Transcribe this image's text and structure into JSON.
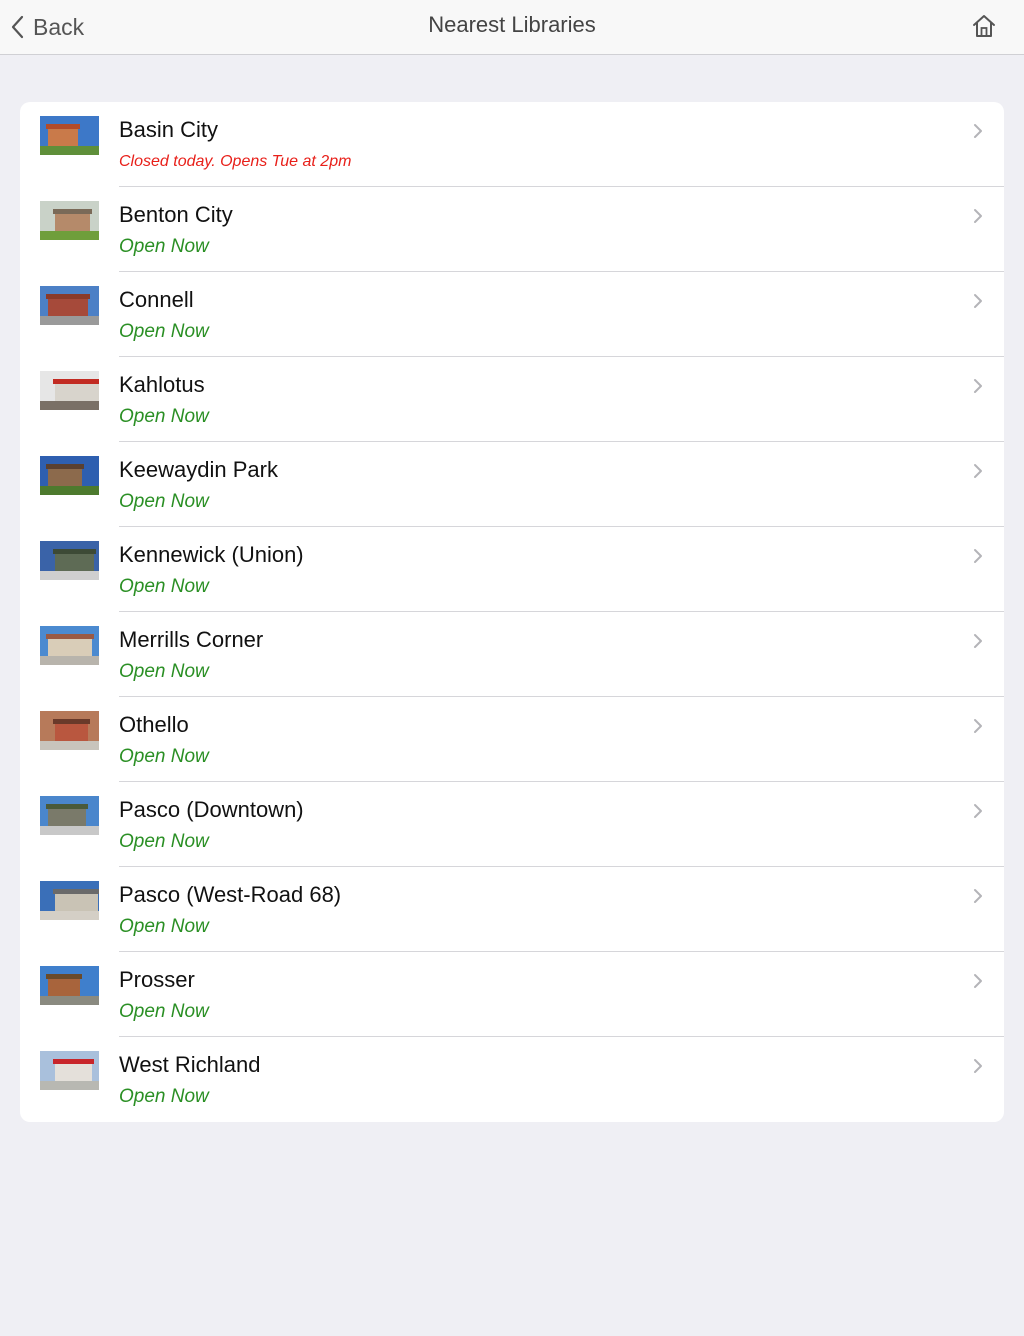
{
  "header": {
    "back_label": "Back",
    "title": "Nearest Libraries"
  },
  "libraries": [
    {
      "name": "Basin City",
      "status": "Closed today. Opens Tue at 2pm",
      "status_kind": "closed",
      "thumb": {
        "sky": "#3d78c8",
        "bldg": "#c97a4a",
        "ground": "#5f8f3a",
        "roof": "#b24b2a"
      }
    },
    {
      "name": "Benton City",
      "status": "Open Now",
      "status_kind": "open",
      "thumb": {
        "sky": "#c9d2c8",
        "bldg": "#b58a6a",
        "ground": "#6f9e3b",
        "roof": "#7a6a58"
      }
    },
    {
      "name": "Connell",
      "status": "Open Now",
      "status_kind": "open",
      "thumb": {
        "sky": "#4c80c6",
        "bldg": "#a64a3a",
        "ground": "#9a9a9a",
        "roof": "#8a3a2a"
      }
    },
    {
      "name": "Kahlotus",
      "status": "Open Now",
      "status_kind": "open",
      "thumb": {
        "sky": "#e6e6e6",
        "bldg": "#d8d4cc",
        "ground": "#7a7066",
        "roof": "#c22b22"
      }
    },
    {
      "name": "Keewaydin Park",
      "status": "Open Now",
      "status_kind": "open",
      "thumb": {
        "sky": "#2e5fb0",
        "bldg": "#8c6a4c",
        "ground": "#4d7a2e",
        "roof": "#5a4030"
      }
    },
    {
      "name": "Kennewick (Union)",
      "status": "Open Now",
      "status_kind": "open",
      "thumb": {
        "sky": "#3a63a8",
        "bldg": "#5e6b55",
        "ground": "#cfcfcf",
        "roof": "#3d4a36"
      }
    },
    {
      "name": "Merrills Corner",
      "status": "Open Now",
      "status_kind": "open",
      "thumb": {
        "sky": "#4b8ad0",
        "bldg": "#d9cdb8",
        "ground": "#b8b4ac",
        "roof": "#9a5a44"
      }
    },
    {
      "name": "Othello",
      "status": "Open Now",
      "status_kind": "open",
      "thumb": {
        "sky": "#b77a5a",
        "bldg": "#b9573f",
        "ground": "#c8c4bc",
        "roof": "#6a3a2a"
      }
    },
    {
      "name": "Pasco (Downtown)",
      "status": "Open Now",
      "status_kind": "open",
      "thumb": {
        "sky": "#4a86cc",
        "bldg": "#7a7a6a",
        "ground": "#c8c8c8",
        "roof": "#4a5a3a"
      }
    },
    {
      "name": "Pasco (West-Road 68)",
      "status": "Open Now",
      "status_kind": "open",
      "thumb": {
        "sky": "#3a6fb8",
        "bldg": "#c9c3b5",
        "ground": "#d4cfc6",
        "roof": "#6a6a6a"
      }
    },
    {
      "name": "Prosser",
      "status": "Open Now",
      "status_kind": "open",
      "thumb": {
        "sky": "#3f7fcc",
        "bldg": "#a8643c",
        "ground": "#8a8a80",
        "roof": "#6a4a2a"
      }
    },
    {
      "name": "West Richland",
      "status": "Open Now",
      "status_kind": "open",
      "thumb": {
        "sky": "#a9c0dc",
        "bldg": "#e4e0da",
        "ground": "#b8b8b2",
        "roof": "#c8252a"
      }
    }
  ]
}
